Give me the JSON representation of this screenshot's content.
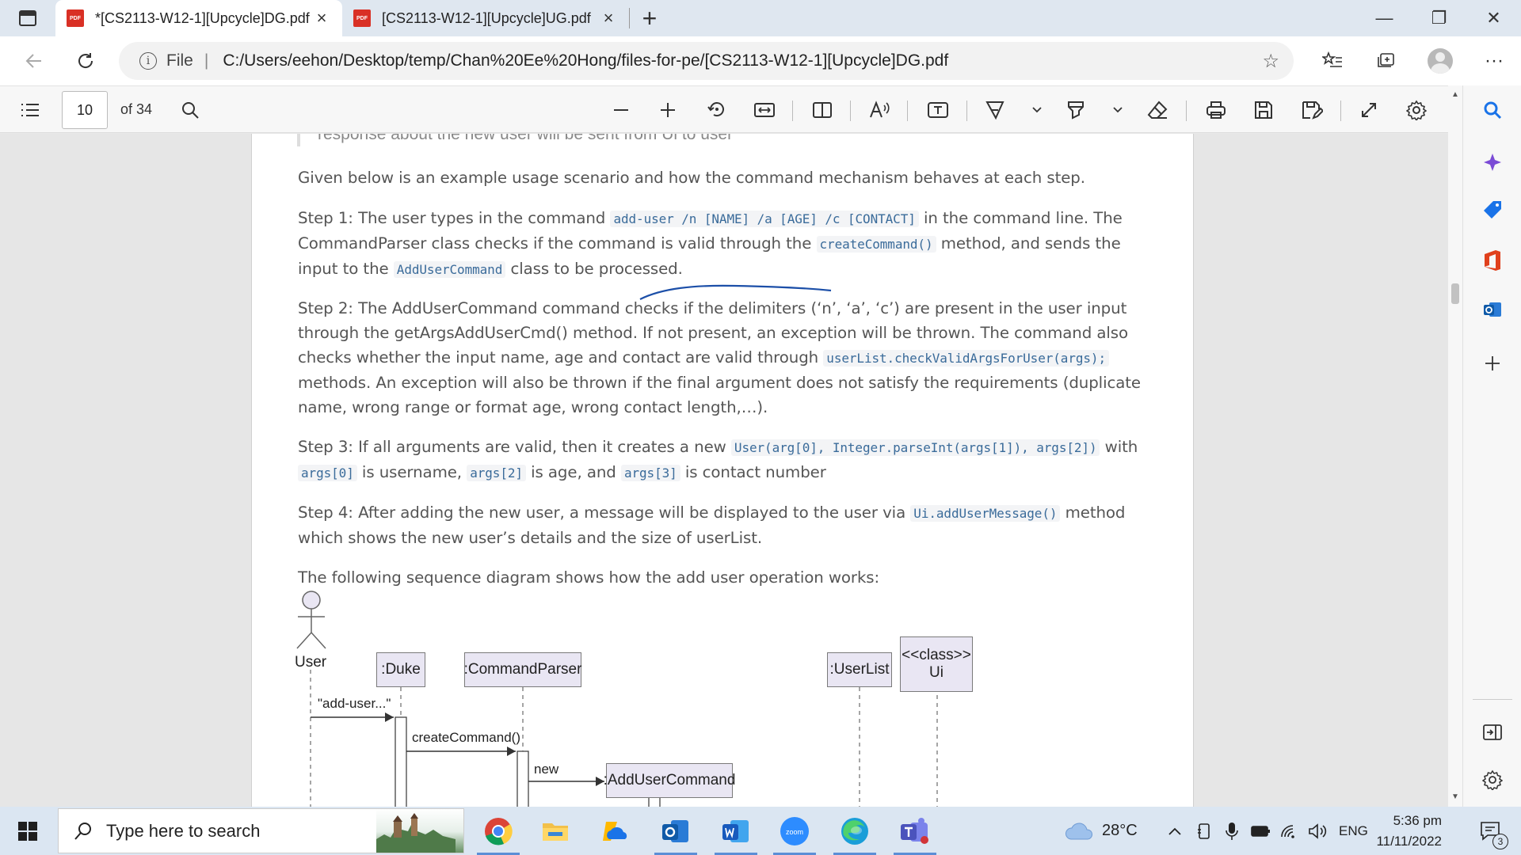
{
  "browser": {
    "tabs": [
      {
        "title": "*[CS2113-W12-1][Upcycle]DG.pdf",
        "active": true
      },
      {
        "title": "[CS2113-W12-1][Upcycle]UG.pdf",
        "active": false
      }
    ],
    "address": {
      "scheme_label": "File",
      "url": "C:/Users/eehon/Desktop/temp/Chan%20Ee%20Hong/files-for-pe/[CS2113-W12-1][Upcycle]DG.pdf"
    },
    "window_controls": {
      "minimize": "—",
      "maximize": "❐",
      "close": "✕"
    }
  },
  "pdf_toolbar": {
    "current_page": "10",
    "total_pages_label": "of 34"
  },
  "document": {
    "quote_text": "response about the new user will be sent from Ui to user",
    "intro": "Given below is an example usage scenario and how the command mechanism behaves at each step.",
    "step1": {
      "t1": "Step 1: The user types in the command ",
      "c1": "add-user /n [NAME] /a [AGE] /c [CONTACT]",
      "t2": " in the command line. The CommandParser class checks if the command is valid through the ",
      "c2": "createCommand()",
      "t3": " method, and sends the input to the ",
      "c3": "AddUserCommand",
      "t4": " class to be processed."
    },
    "step2": {
      "t1": "Step 2: The AddUserCommand command checks if the delimiters (‘n’, ‘a’, ‘c’) are present in the user input through the getArgsAddUserCmd() method. If not present, an exception will be thrown. The command also checks whether the input name, age and contact are valid through ",
      "c1": "userList.checkValidArgsForUser(args);",
      "t2": " methods. An exception will also be thrown if the final argument does not satisfy the requirements (duplicate name, wrong range or format age, wrong contact length,…)."
    },
    "step3": {
      "t1": "Step 3: If all arguments are valid, then it creates a new ",
      "c1": "User(arg[0], Integer.parseInt(args[1]), args[2])",
      "t2": " with ",
      "c2": "args[0]",
      "t3": " is username, ",
      "c3": "args[2]",
      "t4": " is age, and ",
      "c4": "args[3]",
      "t5": " is contact number"
    },
    "step4": {
      "t1": "Step 4: After adding the new user, a message will be displayed to the user via ",
      "c1": "Ui.addUserMessage()",
      "t2": " method which shows the new user’s details and the size of userList."
    },
    "diagram_caption": "The following sequence diagram shows how the add user operation works:"
  },
  "sequence_diagram": {
    "actor_label": "User",
    "participants": {
      "duke": ":Duke",
      "parser": ":CommandParser",
      "userlist": ":UserList",
      "ui_stereotype": "<<class>>",
      "ui_name": "Ui",
      "addusercmd": ":AddUserCommand"
    },
    "messages": {
      "m1": "\"add-user...\"",
      "m2": "createCommand()",
      "m3": "new"
    }
  },
  "taskbar": {
    "search_placeholder": "Type here to search",
    "weather": "28°C",
    "language": "ENG",
    "time": "5:36 pm",
    "date": "11/11/2022",
    "notifications": "3"
  }
}
